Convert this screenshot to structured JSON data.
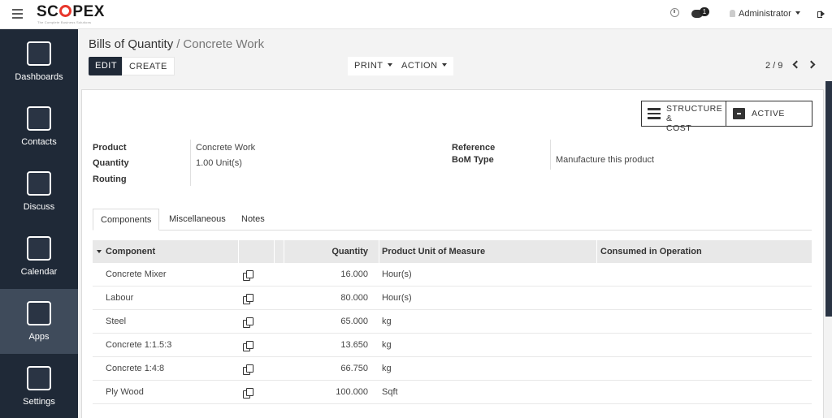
{
  "topbar": {
    "logo": "SCOPEX",
    "logo_tagline": "The Complete Business Solutions",
    "chat_badge": "1",
    "user": "Administrator"
  },
  "sidebar": {
    "items": [
      {
        "label": "Dashboards",
        "icon": "dashboard-icon"
      },
      {
        "label": "Contacts",
        "icon": "contacts-icon"
      },
      {
        "label": "Discuss",
        "icon": "discuss-icon"
      },
      {
        "label": "Calendar",
        "icon": "calendar-icon"
      },
      {
        "label": "Apps",
        "icon": "apps-icon",
        "active": true
      },
      {
        "label": "Settings",
        "icon": "settings-icon"
      }
    ]
  },
  "breadcrumb": {
    "parent": "Bills of Quantity",
    "current": "Concrete Work"
  },
  "toolbar": {
    "edit": "EDIT",
    "create": "CREATE",
    "print": "PRINT",
    "action": "ACTION"
  },
  "pager": {
    "value": "2 / 9"
  },
  "stat_buttons": {
    "structure": "STRUCTURE &",
    "structure2": "COST",
    "active": "ACTIVE"
  },
  "form": {
    "product_label": "Product",
    "product_value": "Concrete Work",
    "quantity_label": "Quantity",
    "quantity_value": "1.00 Unit(s)",
    "routing_label": "Routing",
    "reference_label": "Reference",
    "bom_type_label": "BoM Type",
    "bom_type_value": "Manufacture this product"
  },
  "tabs": [
    "Components",
    "Miscellaneous",
    "Notes"
  ],
  "table": {
    "headers": {
      "component": "Component",
      "quantity": "Quantity",
      "uom": "Product Unit of Measure",
      "consumed": "Consumed in Operation"
    },
    "rows": [
      {
        "component": "Concrete Mixer",
        "quantity": "16.000",
        "uom": "Hour(s)"
      },
      {
        "component": "Labour",
        "quantity": "80.000",
        "uom": "Hour(s)"
      },
      {
        "component": "Steel",
        "quantity": "65.000",
        "uom": "kg"
      },
      {
        "component": "Concrete 1:1.5:3",
        "quantity": "13.650",
        "uom": "kg"
      },
      {
        "component": "Concrete 1:4:8",
        "quantity": "66.750",
        "uom": "kg"
      },
      {
        "component": "Ply Wood",
        "quantity": "100.000",
        "uom": "Sqft"
      }
    ]
  }
}
